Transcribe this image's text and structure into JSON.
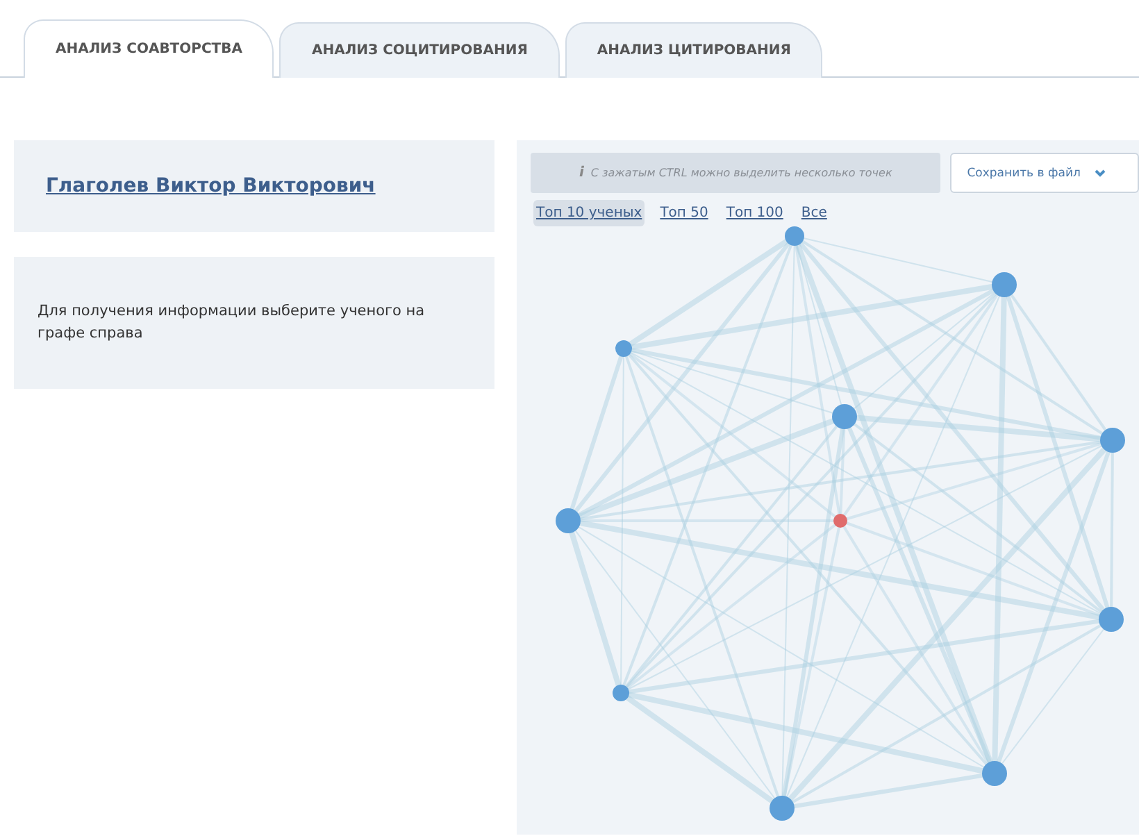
{
  "tabs": [
    {
      "label": "АНАЛИЗ СОАВТОРСТВА",
      "selected": true
    },
    {
      "label": "АНАЛИЗ СОЦИТИРОВАНИЯ",
      "selected": false
    },
    {
      "label": "АНАЛИЗ ЦИТИРОВАНИЯ",
      "selected": false
    }
  ],
  "scientist": {
    "name": "Глаголев Виктор Викторович"
  },
  "info": {
    "text": "Для получения информации выберите ученого на графе справа"
  },
  "graph": {
    "hint_icon": "i",
    "hint": "С зажатым CTRL можно выделить несколько точек",
    "save_button": "Сохранить в файл",
    "filters": [
      {
        "label": "Топ 10 ученых",
        "selected": true
      },
      {
        "label": "Топ 50",
        "selected": false
      },
      {
        "label": "Топ 100",
        "selected": false
      },
      {
        "label": "Все",
        "selected": false
      }
    ]
  }
}
